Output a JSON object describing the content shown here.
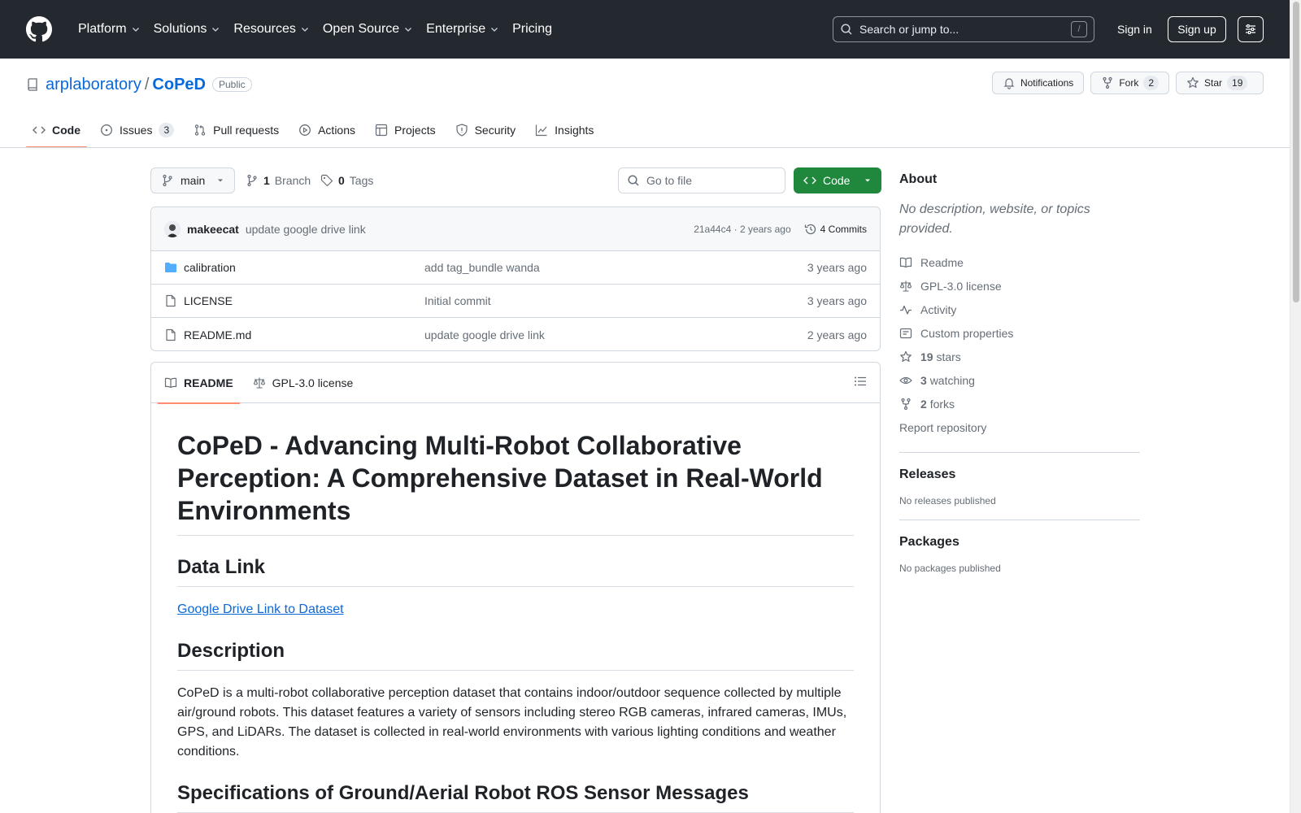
{
  "header": {
    "nav": [
      "Platform",
      "Solutions",
      "Resources",
      "Open Source",
      "Enterprise",
      "Pricing"
    ],
    "search_placeholder": "Search or jump to...",
    "search_key": "/",
    "sign_in": "Sign in",
    "sign_up": "Sign up"
  },
  "repo": {
    "owner": "arplaboratory",
    "separator": "/",
    "name": "CoPeD",
    "visibility": "Public",
    "notifications_label": "Notifications",
    "fork_label": "Fork",
    "fork_count": "2",
    "star_label": "Star",
    "star_count": "19"
  },
  "tabs": [
    {
      "label": "Code",
      "icon": "code-icon"
    },
    {
      "label": "Issues",
      "icon": "issue-icon",
      "count": "3"
    },
    {
      "label": "Pull requests",
      "icon": "pull-request-icon"
    },
    {
      "label": "Actions",
      "icon": "play-icon"
    },
    {
      "label": "Projects",
      "icon": "table-icon"
    },
    {
      "label": "Security",
      "icon": "shield-icon"
    },
    {
      "label": "Insights",
      "icon": "graph-icon"
    }
  ],
  "toolbar": {
    "branch": "main",
    "branch_count": "1",
    "branch_label": "Branch",
    "tag_count": "0",
    "tag_label": "Tags",
    "goto_placeholder": "Go to file",
    "code_label": "Code"
  },
  "commit": {
    "author": "makeecat",
    "message": "update google drive link",
    "hash": "21a44c4",
    "dot": "·",
    "age": "2 years ago",
    "commits": "4 Commits"
  },
  "files": [
    {
      "name": "calibration",
      "type": "folder",
      "commit": "add tag_bundle wanda",
      "date": "3 years ago"
    },
    {
      "name": "LICENSE",
      "type": "file",
      "commit": "Initial commit",
      "date": "3 years ago"
    },
    {
      "name": "README.md",
      "type": "file",
      "commit": "update google drive link",
      "date": "2 years ago"
    }
  ],
  "readme": {
    "tabs": [
      "README",
      "GPL-3.0 license"
    ],
    "h1": "CoPeD - Advancing Multi-Robot Collaborative Perception: A Comprehensive Dataset in Real-World Environments",
    "h2_data": "Data Link",
    "data_link": "Google Drive Link to Dataset",
    "h2_desc": "Description",
    "desc": "CoPeD is a multi-robot collaborative perception dataset that contains indoor/outdoor sequence collected by multiple air/ground robots. This dataset features a variety of sensors including stereo RGB cameras, infrared cameras, IMUs, GPS, and LiDARs. The dataset is collected in real-world environments with various lighting conditions and weather conditions.",
    "h2_specs": "Specifications of Ground/Aerial Robot ROS Sensor Messages"
  },
  "sidebar": {
    "about_title": "About",
    "about_desc": "No description, website, or topics provided.",
    "items": [
      {
        "icon": "book-icon",
        "label": "Readme"
      },
      {
        "icon": "law-icon",
        "label": "GPL-3.0 license"
      },
      {
        "icon": "pulse-icon",
        "label": "Activity"
      },
      {
        "icon": "note-icon",
        "label": "Custom properties"
      },
      {
        "icon": "star-icon",
        "count": "19",
        "label": "stars"
      },
      {
        "icon": "eye-icon",
        "count": "3",
        "label": "watching"
      },
      {
        "icon": "fork-icon",
        "count": "2",
        "label": "forks"
      }
    ],
    "report": "Report repository",
    "releases_title": "Releases",
    "releases_empty": "No releases published",
    "packages_title": "Packages",
    "packages_empty": "No packages published"
  },
  "colors": {
    "header_bg": "#24292f",
    "link": "#0969da",
    "primary_button": "#1f883d",
    "tab_underline": "#fd8c73",
    "folder": "#54aeff"
  }
}
